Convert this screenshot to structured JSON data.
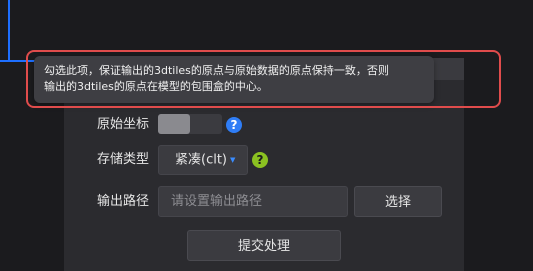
{
  "tooltip": {
    "line1": "勾选此项，保证输出的3dtiles的原点与原始数据的原点保持一致，否则",
    "line2": "输出的3dtiles的原点在模型的包围盒的中心。"
  },
  "form": {
    "original_coords_label": "原始坐标",
    "storage_type_label": "存储类型",
    "storage_type_value": "紧凑(clt)",
    "output_path_label": "输出路径",
    "output_path_placeholder": "请设置输出路径",
    "choose_button": "选择",
    "submit_button": "提交处理"
  },
  "icons": {
    "help_blue": "question-icon",
    "help_green": "question-icon"
  },
  "colors": {
    "highlight": "#e04c4c",
    "accent_blue": "#2f7df6",
    "accent_green": "#8bc121"
  }
}
